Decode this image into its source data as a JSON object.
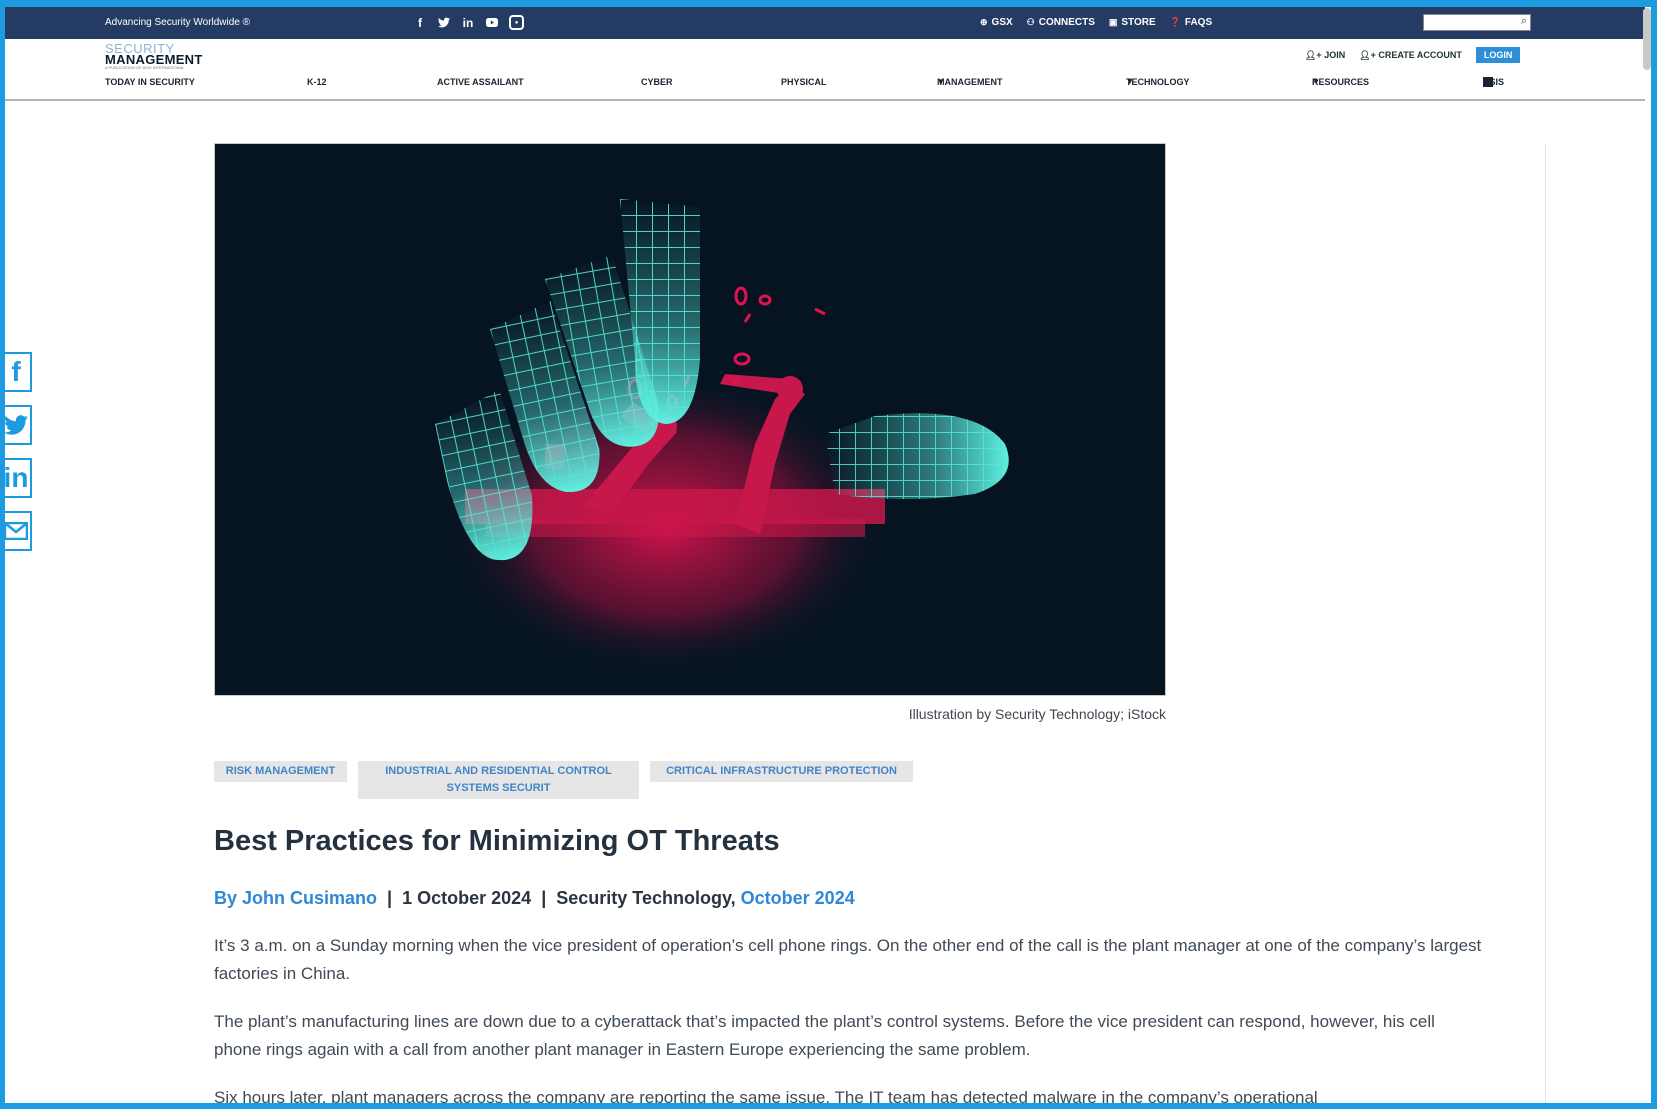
{
  "topbar": {
    "tagline": "Advancing Security Worldwide ®",
    "social_icons": [
      "facebook-icon",
      "twitter-icon",
      "linkedin-icon",
      "youtube-icon",
      "instagram-icon"
    ],
    "quick_links": [
      {
        "label": "GSX",
        "icon": "globe-icon"
      },
      {
        "label": "CONNECTS",
        "icon": "people-icon"
      },
      {
        "label": "STORE",
        "icon": "store-icon"
      },
      {
        "label": "FAQS",
        "icon": "question-icon"
      }
    ],
    "search_value": ""
  },
  "header": {
    "logo_line1": "SECURITY",
    "logo_line2": "MANAGEMENT",
    "logo_line3": "A PUBLICATION OF ASIS INTERNATIONAL",
    "join_label": "JOIN",
    "create_account_label": "CREATE ACCOUNT",
    "login_label": "LOGIN"
  },
  "nav": {
    "items": [
      {
        "label": "TODAY IN SECURITY",
        "dropdown": false
      },
      {
        "label": "K-12",
        "dropdown": false
      },
      {
        "label": "ACTIVE ASSAILANT",
        "dropdown": false
      },
      {
        "label": "CYBER",
        "dropdown": false
      },
      {
        "label": "PHYSICAL",
        "dropdown": false
      },
      {
        "label": "MANAGEMENT",
        "dropdown": true
      },
      {
        "label": "TECHNOLOGY",
        "dropdown": true
      },
      {
        "label": "RESOURCES",
        "dropdown": true
      },
      {
        "label": "ASIS",
        "dropdown": true
      }
    ]
  },
  "article": {
    "image_caption": "Illustration by Security Technology; iStock",
    "tags": [
      "RISK MANAGEMENT",
      "INDUSTRIAL AND RESIDENTIAL CONTROL SYSTEMS SECURIT",
      "CRITICAL INFRASTRUCTURE PROTECTION"
    ],
    "title": "Best Practices for Minimizing OT Threats",
    "author": "By John Cusimano",
    "date": "1 October 2024",
    "section": "Security Technology,",
    "issue": "October 2024",
    "separator": "|",
    "paragraphs": [
      "It’s 3 a.m. on a Sunday morning when the vice president of operation’s cell phone rings. On the other end of the call is the plant manager at one of the company’s largest factories in China.",
      "The plant’s manufacturing lines are down due to a cyberattack that’s impacted the plant’s control systems. Before the vice president can respond, however, his cell phone rings again with a call from another plant manager in Eastern Europe experiencing the same problem.",
      "Six hours later, plant managers across the company are reporting the same issue. The IT team has detected malware in the company’s operational"
    ]
  },
  "share": [
    "facebook-share-icon",
    "twitter-share-icon",
    "linkedin-share-icon",
    "email-share-icon"
  ],
  "colors": {
    "topbar": "#243b63",
    "accent": "#2f88d6",
    "frame": "#1d9be0",
    "hand": "#55e6d8",
    "robot": "#c8174a"
  }
}
